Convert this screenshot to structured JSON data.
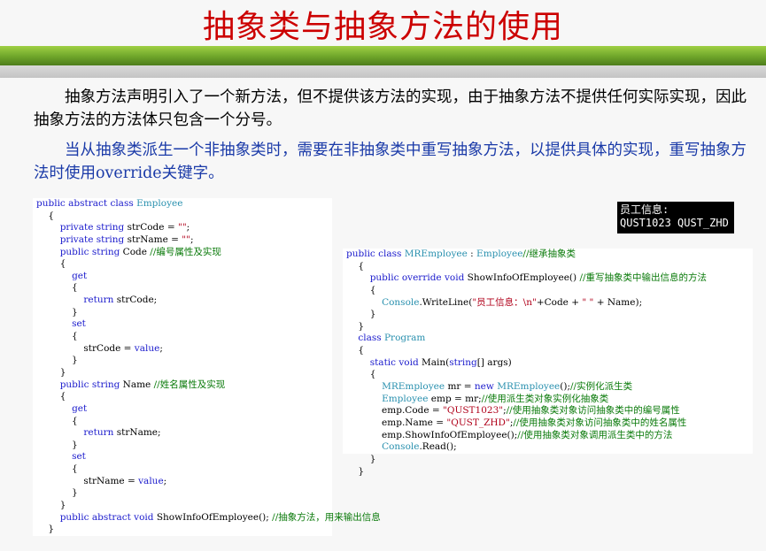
{
  "slide": {
    "title": "抽象类与抽象方法的使用",
    "paragraph1": "抽象方法声明引入了一个新方法，但不提供该方法的实现，由于抽象方法不提供任何实际实现，因此抽象方法的方法体只包含一个分号。",
    "paragraph2": "当从抽象类派生一个非抽象类时，需要在非抽象类中重写抽象方法，以提供具体的实现，重写抽象方法时使用override关键字。"
  },
  "console_output": {
    "line1": "员工信息:",
    "line2": "QUST1023 QUST_ZHD"
  },
  "code_left": [
    [
      [
        "kw",
        "public abstract class "
      ],
      [
        "ty",
        "Employee"
      ]
    ],
    [
      [
        "",
        "    {"
      ]
    ],
    [
      [
        "",
        "        "
      ],
      [
        "kw",
        "private string "
      ],
      [
        "",
        "strCode = "
      ],
      [
        "st",
        "\"\""
      ],
      [
        "",
        ";"
      ]
    ],
    [
      [
        "",
        "        "
      ],
      [
        "kw",
        "private string "
      ],
      [
        "",
        "strName = "
      ],
      [
        "st",
        "\"\""
      ],
      [
        "",
        ";"
      ]
    ],
    [
      [
        "",
        "        "
      ],
      [
        "kw",
        "public string "
      ],
      [
        "",
        "Code "
      ],
      [
        "cm",
        "//编号属性及实现"
      ]
    ],
    [
      [
        "",
        "        {"
      ]
    ],
    [
      [
        "",
        "            "
      ],
      [
        "kw",
        "get"
      ]
    ],
    [
      [
        "",
        "            {"
      ]
    ],
    [
      [
        "",
        "                "
      ],
      [
        "kw",
        "return "
      ],
      [
        "",
        "strCode;"
      ]
    ],
    [
      [
        "",
        "            }"
      ]
    ],
    [
      [
        "",
        "            "
      ],
      [
        "kw",
        "set"
      ]
    ],
    [
      [
        "",
        "            {"
      ]
    ],
    [
      [
        "",
        "                strCode = "
      ],
      [
        "kw",
        "value"
      ],
      [
        "",
        ";"
      ]
    ],
    [
      [
        "",
        "            }"
      ]
    ],
    [
      [
        "",
        "        }"
      ]
    ],
    [
      [
        "",
        "        "
      ],
      [
        "kw",
        "public string "
      ],
      [
        "",
        "Name "
      ],
      [
        "cm",
        "//姓名属性及实现"
      ]
    ],
    [
      [
        "",
        "        {"
      ]
    ],
    [
      [
        "",
        "            "
      ],
      [
        "kw",
        "get"
      ]
    ],
    [
      [
        "",
        "            {"
      ]
    ],
    [
      [
        "",
        "                "
      ],
      [
        "kw",
        "return "
      ],
      [
        "",
        "strName;"
      ]
    ],
    [
      [
        "",
        "            }"
      ]
    ],
    [
      [
        "",
        "            "
      ],
      [
        "kw",
        "set"
      ]
    ],
    [
      [
        "",
        "            {"
      ]
    ],
    [
      [
        "",
        "                strName = "
      ],
      [
        "kw",
        "value"
      ],
      [
        "",
        ";"
      ]
    ],
    [
      [
        "",
        "            }"
      ]
    ],
    [
      [
        "",
        "        }"
      ]
    ],
    [
      [
        "",
        "        "
      ],
      [
        "kw",
        "public abstract void "
      ],
      [
        "",
        "ShowInfoOfEmployee(); "
      ],
      [
        "cm",
        "//抽象方法，用来输出信息"
      ]
    ],
    [
      [
        "",
        "    }"
      ]
    ]
  ],
  "code_right": [
    [
      [
        "kw",
        "public class "
      ],
      [
        "ty",
        "MREmployee"
      ],
      [
        "",
        " : "
      ],
      [
        "ty",
        "Employee"
      ],
      [
        "cm",
        "//继承抽象类"
      ]
    ],
    [
      [
        "",
        "    {"
      ]
    ],
    [
      [
        "",
        "        "
      ],
      [
        "kw",
        "public override void "
      ],
      [
        "",
        "ShowInfoOfEmployee() "
      ],
      [
        "cm",
        "//重写抽象类中输出信息的方法"
      ]
    ],
    [
      [
        "",
        "        {"
      ]
    ],
    [
      [
        "",
        "            "
      ],
      [
        "ty",
        "Console"
      ],
      [
        "",
        ".WriteLine("
      ],
      [
        "st",
        "\"员工信息：\\n\""
      ],
      [
        "",
        "+Code + "
      ],
      [
        "st",
        "\" \""
      ],
      [
        "",
        " + Name);"
      ]
    ],
    [
      [
        "",
        "        }"
      ]
    ],
    [
      [
        "",
        "    }"
      ]
    ],
    [
      [
        "",
        "    "
      ],
      [
        "kw",
        "class "
      ],
      [
        "ty",
        "Program"
      ]
    ],
    [
      [
        "",
        "    {"
      ]
    ],
    [
      [
        "",
        "        "
      ],
      [
        "kw",
        "static void "
      ],
      [
        "",
        "Main("
      ],
      [
        "kw",
        "string"
      ],
      [
        "",
        "[] args)"
      ]
    ],
    [
      [
        "",
        "        {"
      ]
    ],
    [
      [
        "",
        "            "
      ],
      [
        "ty",
        "MREmployee"
      ],
      [
        "",
        " mr = "
      ],
      [
        "kw",
        "new "
      ],
      [
        "ty",
        "MREmployee"
      ],
      [
        "",
        "();"
      ],
      [
        "cm",
        "//实例化派生类"
      ]
    ],
    [
      [
        "",
        "            "
      ],
      [
        "ty",
        "Employee"
      ],
      [
        "",
        " emp = mr;"
      ],
      [
        "cm",
        "//使用派生类对象实例化抽象类"
      ]
    ],
    [
      [
        "",
        "            emp.Code = "
      ],
      [
        "st",
        "\"QUST1023\""
      ],
      [
        "",
        ";"
      ],
      [
        "cm",
        "//使用抽象类对象访问抽象类中的编号属性"
      ]
    ],
    [
      [
        "",
        "            emp.Name = "
      ],
      [
        "st",
        "\"QUST_ZHD\""
      ],
      [
        "",
        ";"
      ],
      [
        "cm",
        "//使用抽象类对象访问抽象类中的姓名属性"
      ]
    ],
    [
      [
        "",
        "            emp.ShowInfoOfEmployee();"
      ],
      [
        "cm",
        "//使用抽象类对象调用派生类中的方法"
      ]
    ],
    [
      [
        "",
        "            "
      ],
      [
        "ty",
        "Console"
      ],
      [
        "",
        ".Read();"
      ]
    ],
    [
      [
        "",
        "        }"
      ]
    ],
    [
      [
        "",
        "    }"
      ]
    ]
  ]
}
